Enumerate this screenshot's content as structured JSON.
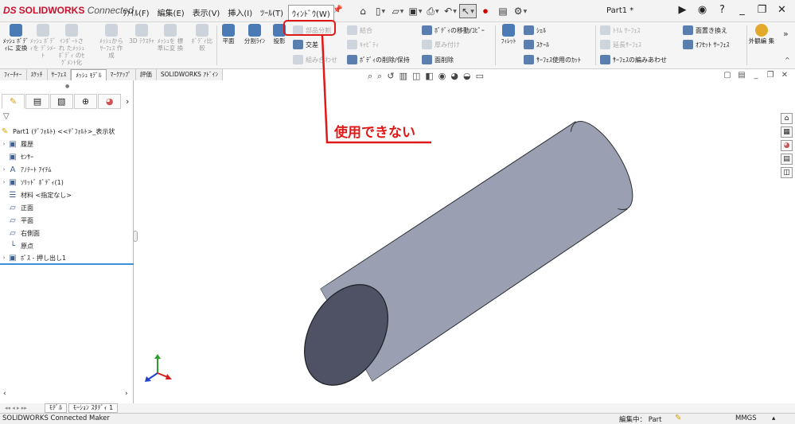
{
  "app": {
    "logo_prefix": "DS",
    "logo_main": "SOLIDWORKS",
    "logo_suffix": "Connected",
    "doc_title": "Part1 *"
  },
  "menu": [
    {
      "label": "ﾌｧｲﾙ(F)"
    },
    {
      "label": "編集(E)"
    },
    {
      "label": "表示(V)"
    },
    {
      "label": "挿入(I)"
    },
    {
      "label": "ﾂｰﾙ(T)"
    },
    {
      "label": "ｳｨﾝﾄﾞｳ(W)"
    }
  ],
  "ribbon": {
    "big_buttons": [
      {
        "label": "ﾒｯｼｭ ﾎﾞﾃﾞｨに 変換",
        "enabled": true
      },
      {
        "label": "ﾒｯｼｭ ﾎﾞﾃﾞｨを ﾃﾞｼﾒｰﾄ",
        "enabled": false
      },
      {
        "label": "ｲﾝﾎﾟｰﾄされ たﾒｯｼｭ ﾎﾞﾃﾞｨ のｾｸﾞﾒﾝﾄ化",
        "enabled": false
      },
      {
        "label": "ﾒｯｼｭから ｻｰﾌｪｽ 作成",
        "enabled": false
      },
      {
        "label": "3D ﾃｸｽﾁｬ",
        "enabled": false
      },
      {
        "label": "ﾒｯｼｭを 標準に変 換",
        "enabled": false
      },
      {
        "label": "ﾎﾞﾃﾞｨ比 較",
        "enabled": false
      },
      {
        "label": "平面",
        "enabled": true
      },
      {
        "label": "分割ﾗｲﾝ",
        "enabled": true
      },
      {
        "label": "投影",
        "enabled": true
      }
    ],
    "col1": [
      "部品分割",
      "交差",
      "組み合わせ"
    ],
    "col2": [
      "結合",
      "ｷｬﾋﾞﾃｨ",
      "ﾎﾞﾃﾞｨの削除/保持"
    ],
    "col3": [
      "ﾎﾞﾃﾞｨの移動/ｺﾋﾟｰ",
      "厚み付け",
      "面削除"
    ],
    "fillet": "ﾌｨﾚｯﾄ",
    "col4": [
      "ｼｪﾙ",
      "ｽｹｰﾙ",
      "ｻｰﾌｪｽ使用のｶｯﾄ"
    ],
    "col5": [
      "ﾄﾘﾑ ｻｰﾌｪｽ",
      "延長ｻｰﾌｪｽ",
      "ｻｰﾌｪｽの編みあわせ"
    ],
    "col6": [
      "面置き換え",
      "ｵﾌｾｯﾄ ｻｰﾌｪｽ"
    ],
    "appearance": "外観編 集",
    "more": "»",
    "collapse": "^"
  },
  "tabs": [
    {
      "label": "ﾌｨｰﾁｬｰ",
      "active": false
    },
    {
      "label": "ｽｹｯﾁ",
      "active": false
    },
    {
      "label": "ｻｰﾌｪｽ",
      "active": false
    },
    {
      "label": "ﾒｯｼｭ ﾓﾃﾞﾙ",
      "active": true
    },
    {
      "label": "ﾏｰｸｱｯﾌﾟ",
      "active": false
    },
    {
      "label": "評価",
      "active": false
    },
    {
      "label": "SOLIDWORKS ｱﾄﾞｲﾝ",
      "active": false
    }
  ],
  "tree": {
    "top": "Part1 (ﾃﾞﾌｫﾙﾄ) <<ﾃﾞﾌｫﾙﾄ>_表示状",
    "items": [
      {
        "label": "履歴",
        "expander": "›"
      },
      {
        "label": "ｾﾝｻｰ",
        "expander": ""
      },
      {
        "label": "ｱﾉﾃｰﾄ ｱｲﾃﾑ",
        "expander": "›"
      },
      {
        "label": "ｿﾘｯﾄﾞ ﾎﾞﾃﾞｨ(1)",
        "expander": "›"
      },
      {
        "label": "材料 <指定なし>",
        "expander": ""
      },
      {
        "label": "正面",
        "expander": ""
      },
      {
        "label": "平面",
        "expander": ""
      },
      {
        "label": "右側面",
        "expander": ""
      },
      {
        "label": "原点",
        "expander": ""
      },
      {
        "label": "ﾎﾞｽ - 押し出し1",
        "expander": "›"
      }
    ]
  },
  "model_tabs": [
    "ﾓﾃﾞﾙ",
    "ﾓｰｼｮﾝ ｽﾀﾃﾞｨ 1"
  ],
  "status": {
    "left": "SOLIDWORKS Connected Maker",
    "editing": "編集中： Part",
    "units": "MMGS",
    "caret": "▴"
  },
  "annotation": {
    "text": "使用できない",
    "color": "#e01818"
  },
  "colors": {
    "accent_red": "#e01818",
    "cylinder_body": "#9aa0b2",
    "cylinder_face": "#4e5264"
  }
}
